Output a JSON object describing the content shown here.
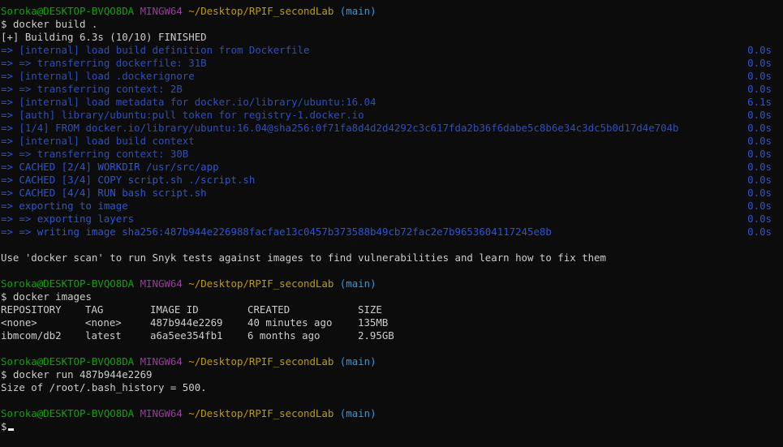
{
  "prompt": {
    "user_host": "Soroka@DESKTOP-BVQO8DA",
    "env": "MINGW64",
    "path": "~/Desktop/RPIF_secondLab",
    "branch": "(main)",
    "symbol": "$"
  },
  "build": {
    "command": "docker build .",
    "status": "[+] Building 6.3s (10/10) FINISHED",
    "steps": [
      {
        "prefix": "=> ",
        "text": "[internal] load build definition from Dockerfile",
        "time": "0.0s",
        "style": "dim"
      },
      {
        "prefix": "=> ",
        "text": "=> transferring dockerfile: 31B",
        "time": "0.0s",
        "style": "dim"
      },
      {
        "prefix": "=> ",
        "text": "[internal] load .dockerignore",
        "time": "0.0s",
        "style": "dim"
      },
      {
        "prefix": "=> ",
        "text": "=> transferring context: 2B",
        "time": "0.0s",
        "style": "dim"
      },
      {
        "prefix": "=> ",
        "text": "[internal] load metadata for docker.io/library/ubuntu:16.04",
        "time": "6.1s",
        "style": "dim"
      },
      {
        "prefix": "=> ",
        "text": "[auth] library/ubuntu:pull token for registry-1.docker.io",
        "time": "0.0s",
        "style": "dim"
      },
      {
        "prefix": "=> ",
        "text": "[1/4] FROM docker.io/library/ubuntu:16.04@sha256:0f71fa8d4d2d4292c3c617fda2b36f6dabe5c8b6e34c3dc5b0d17d4e704b",
        "time": "0.0s",
        "style": "dim"
      },
      {
        "prefix": "=> ",
        "text": "[internal] load build context",
        "time": "0.0s",
        "style": "dim"
      },
      {
        "prefix": "=> ",
        "text": "=> transferring context: 30B",
        "time": "0.0s",
        "style": "dim"
      },
      {
        "prefix": "=> ",
        "text": "CACHED [2/4] WORKDIR /usr/src/app",
        "time": "0.0s",
        "style": "bright"
      },
      {
        "prefix": "=> ",
        "text": "CACHED [3/4] COPY script.sh ./script.sh",
        "time": "0.0s",
        "style": "bright"
      },
      {
        "prefix": "=> ",
        "text": "CACHED [4/4] RUN bash script.sh",
        "time": "0.0s",
        "style": "bright"
      },
      {
        "prefix": "=> ",
        "text": "exporting to image",
        "time": "0.0s",
        "style": "bright"
      },
      {
        "prefix": "=> ",
        "text": "=> exporting layers",
        "time": "0.0s",
        "style": "bright"
      },
      {
        "prefix": "=> ",
        "text": "=> writing image sha256:487b944e226988facfae13c0457b373588b49cb72fac2e7b9653604117245e8b",
        "time": "0.0s",
        "style": "bright"
      }
    ],
    "scan_hint": "Use 'docker scan' to run Snyk tests against images to find vulnerabilities and learn how to fix them"
  },
  "images": {
    "command": "docker images",
    "headers": [
      "REPOSITORY",
      "TAG",
      "IMAGE ID",
      "CREATED",
      "SIZE"
    ],
    "rows": [
      [
        "<none>",
        "<none>",
        "487b944e2269",
        "40 minutes ago",
        "135MB"
      ],
      [
        "ibmcom/db2",
        "latest",
        "a6a5ee354fb1",
        "6 months ago",
        "2.95GB"
      ]
    ]
  },
  "run": {
    "command": "docker run 487b944e2269",
    "output": "Size of /root/.bash_history = 500."
  },
  "colors": {
    "background": "#0c0c0c",
    "text": "#cccccc",
    "user_host": "#13a10e",
    "env": "#a335a3",
    "path": "#c19c00",
    "branch": "#3a96dd",
    "build_step": "#2c55d6"
  }
}
